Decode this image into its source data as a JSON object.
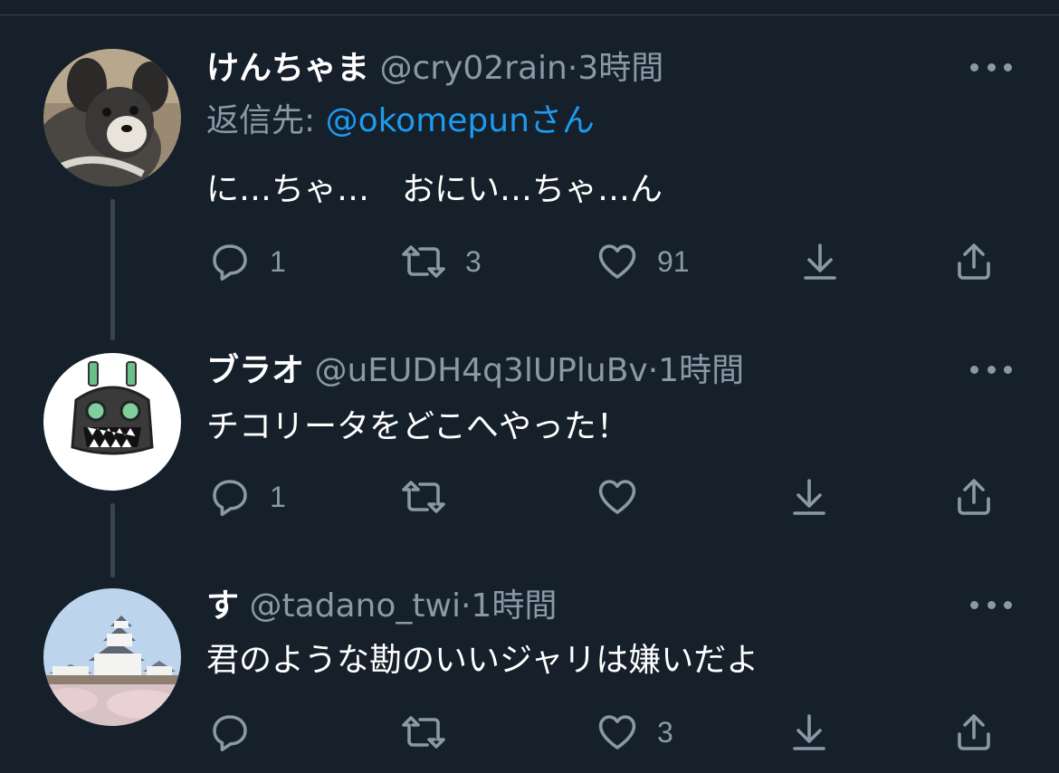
{
  "tweets": [
    {
      "name": "けんちゃま",
      "handle": "@cry02rain",
      "dot": "·",
      "time": "3時間",
      "reply_to_label": "返信先: ",
      "reply_to_mention": "@okomepunさん",
      "text": "に…ちゃ…　おにい…ちゃ…ん",
      "counts": {
        "reply": "1",
        "retweet": "3",
        "like": "91"
      },
      "avatar_icon": "dog-photo-avatar"
    },
    {
      "name": "ブラオ",
      "handle": "@uEUDH4q3lUPluBv",
      "dot": "·",
      "time": "1時間",
      "text": "チコリータをどこへやった！",
      "counts": {
        "reply": "1",
        "retweet": "",
        "like": ""
      },
      "avatar_icon": "robot-monster-avatar"
    },
    {
      "name": "す",
      "handle": "@tadano_twi",
      "dot": "·",
      "time": "1時間",
      "text": "君のような勘のいいジャリは嫌いだよ",
      "counts": {
        "reply": "",
        "retweet": "",
        "like": "3"
      },
      "avatar_icon": "castle-photo-avatar"
    }
  ],
  "icons": {
    "reply": "reply-icon",
    "retweet": "retweet-icon",
    "like": "heart-icon",
    "save": "download-icon",
    "share": "share-icon",
    "more": "more-dots-icon"
  },
  "colors": {
    "background": "#15202b",
    "secondary_text": "#8b98a5",
    "link": "#1d9bf0",
    "divider": "#38444d"
  }
}
